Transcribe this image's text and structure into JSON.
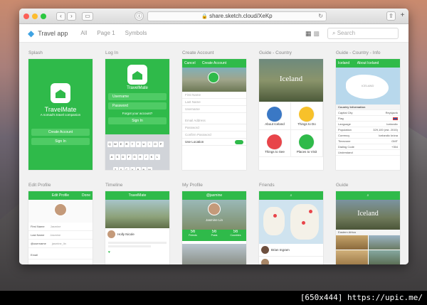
{
  "browser": {
    "url": "share.sketch.cloud/XeKp"
  },
  "app": {
    "title": "Travel app",
    "nav": [
      "All",
      "Page 1",
      "Symbols"
    ],
    "search_placeholder": "Search"
  },
  "colors": {
    "accent": "#2fba4a",
    "brand_icon": "#3fa3e3"
  },
  "artboards": [
    {
      "label": "Splash"
    },
    {
      "label": "Log In"
    },
    {
      "label": "Create Account"
    },
    {
      "label": "Guide - Country"
    },
    {
      "label": "Guide - Country - Info"
    },
    {
      "label": "Edit Profile"
    },
    {
      "label": "Timeline"
    },
    {
      "label": "My Profile"
    },
    {
      "label": "Friends"
    },
    {
      "label": "Guide"
    }
  ],
  "splash": {
    "brand": "TravelMate",
    "tagline": "A nomad's travel companion",
    "create_btn": "Create Account",
    "signin_btn": "Sign In"
  },
  "login": {
    "brand": "TravelMate",
    "username": "Username",
    "password": "Password",
    "forgot": "Forgot your account?",
    "signin_btn": "Sign In",
    "space_key": "space"
  },
  "create_account": {
    "header_left": "Cancel",
    "header_title": "Create Account",
    "fields": [
      "First Name",
      "Last Name",
      "Username",
      "Email Address",
      "Password",
      "Confirm Password"
    ],
    "location_label": "Use Location"
  },
  "guide_country": {
    "country": "Iceland",
    "tiles": [
      "About Iceland",
      "Things to Do",
      "Things to See",
      "Places to Visit"
    ]
  },
  "country_info": {
    "back": "Iceland",
    "header_title": "About Iceland",
    "map_label": "ICELAND",
    "section": "Country Information",
    "rows": [
      {
        "k": "Capital City",
        "v": "Reykjavík"
      },
      {
        "k": "Flag",
        "v": ""
      },
      {
        "k": "Language",
        "v": "Icelandic"
      },
      {
        "k": "Population",
        "v": "329,100 (est. 2015)"
      },
      {
        "k": "Currency",
        "v": "Icelandic króna"
      },
      {
        "k": "Timezone",
        "v": "GMT"
      },
      {
        "k": "Dialing Code",
        "v": "+354"
      },
      {
        "k": "Understand",
        "v": ""
      }
    ]
  },
  "edit_profile": {
    "header_title": "Edit Profile",
    "header_right": "Done",
    "rows": [
      {
        "k": "First Name",
        "v": "Jasmine"
      },
      {
        "k": "Last Name",
        "v": "Jasmine"
      },
      {
        "k": "@username",
        "v": "jasmine_lin"
      },
      {
        "k": "Email",
        "v": ""
      }
    ]
  },
  "timeline": {
    "header_title": "TravelMate",
    "post_name": "Holly Nicole"
  },
  "my_profile": {
    "header_title": "@jasmine",
    "name": "Jasmine Lin",
    "stats": [
      {
        "num": "56",
        "label": "Friends"
      },
      {
        "num": "56",
        "label": "Posts"
      },
      {
        "num": "56",
        "label": "Countries"
      }
    ]
  },
  "friends": {
    "friend_name": "Brian Ingram"
  },
  "guide": {
    "hero": "Iceland",
    "section": "Eastern Africa"
  },
  "footer": {
    "text": "[650x444] https://upic.me/"
  }
}
